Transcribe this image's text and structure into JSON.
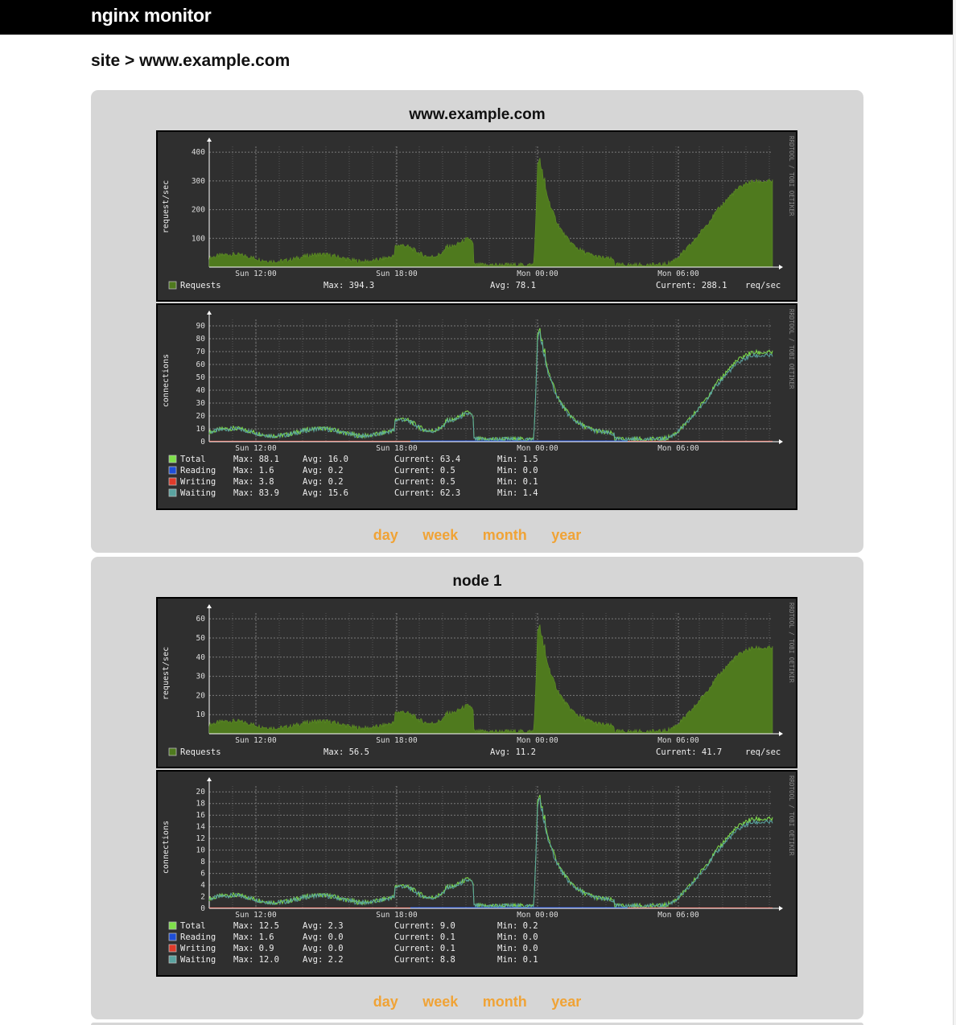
{
  "app": {
    "title": "nginx monitor"
  },
  "breadcrumb": "site > www.example.com",
  "panels": [
    {
      "title": "www.example.com",
      "links": [
        "day",
        "week",
        "month",
        "year"
      ],
      "requests_graph": {
        "ylabel": "request/sec",
        "watermark": "RRDTOOL / TOBI OETIKER",
        "yticks": [
          "100",
          "200",
          "300",
          "400"
        ],
        "ymax": 420,
        "xticks": [
          "Sun 12:00",
          "Sun 18:00",
          "Mon 00:00",
          "Mon 06:00"
        ],
        "legend": {
          "name": "Requests",
          "max": "Max: 394.3",
          "avg": "Avg:  78.1",
          "current": "Current: 288.1",
          "unit": "req/sec",
          "color": "#4f7a1e"
        }
      },
      "connections_graph": {
        "ylabel": "connections",
        "watermark": "RRDTOOL / TOBI OETIKER",
        "yticks": [
          "0",
          "10",
          "20",
          "30",
          "40",
          "50",
          "60",
          "70",
          "80",
          "90"
        ],
        "ymax": 95,
        "xticks": [
          "Sun 12:00",
          "Sun 18:00",
          "Mon 00:00",
          "Mon 06:00"
        ],
        "legend": [
          {
            "name": "Total",
            "max": "Max:  88.1",
            "avg": "Avg:  16.0",
            "current": "Current:  63.4",
            "min": "Min:   1.5",
            "color": "#7fe04a"
          },
          {
            "name": "Reading",
            "max": "Max:   1.6",
            "avg": "Avg:   0.2",
            "current": "Current:   0.5",
            "min": "Min:   0.0",
            "color": "#1e4ed8"
          },
          {
            "name": "Writing",
            "max": "Max:   3.8",
            "avg": "Avg:   0.2",
            "current": "Current:   0.5",
            "min": "Min:   0.1",
            "color": "#e03b2a"
          },
          {
            "name": "Waiting",
            "max": "Max:  83.9",
            "avg": "Avg:  15.6",
            "current": "Current:  62.3",
            "min": "Min:   1.4",
            "color": "#5aa3a0"
          }
        ]
      }
    },
    {
      "title": "node 1",
      "links": [
        "day",
        "week",
        "month",
        "year"
      ],
      "requests_graph": {
        "ylabel": "request/sec",
        "watermark": "RRDTOOL / TOBI OETIKER",
        "yticks": [
          "10",
          "20",
          "30",
          "40",
          "50",
          "60"
        ],
        "ymax": 63,
        "xticks": [
          "Sun 12:00",
          "Sun 18:00",
          "Mon 00:00",
          "Mon 06:00"
        ],
        "legend": {
          "name": "Requests",
          "max": "Max:  56.5",
          "avg": "Avg:  11.2",
          "current": "Current:  41.7",
          "unit": "req/sec",
          "color": "#4f7a1e"
        }
      },
      "connections_graph": {
        "ylabel": "connections",
        "watermark": "RRDTOOL / TOBI OETIKER",
        "yticks": [
          "0",
          "2",
          "4",
          "6",
          "8",
          "10",
          "12",
          "14",
          "16",
          "18",
          "20"
        ],
        "ymax": 21,
        "xticks": [
          "Sun 12:00",
          "Sun 18:00",
          "Mon 00:00",
          "Mon 06:00"
        ],
        "legend": [
          {
            "name": "Total",
            "max": "Max:  12.5",
            "avg": "Avg:   2.3",
            "current": "Current:   9.0",
            "min": "Min:   0.2",
            "color": "#7fe04a"
          },
          {
            "name": "Reading",
            "max": "Max:   1.6",
            "avg": "Avg:   0.0",
            "current": "Current:   0.1",
            "min": "Min:   0.0",
            "color": "#1e4ed8"
          },
          {
            "name": "Writing",
            "max": "Max:   0.9",
            "avg": "Avg:   0.0",
            "current": "Current:   0.1",
            "min": "Min:   0.0",
            "color": "#e03b2a"
          },
          {
            "name": "Waiting",
            "max": "Max:  12.0",
            "avg": "Avg:   2.2",
            "current": "Current:   8.8",
            "min": "Min:   0.1",
            "color": "#5aa3a0"
          }
        ]
      }
    }
  ]
}
